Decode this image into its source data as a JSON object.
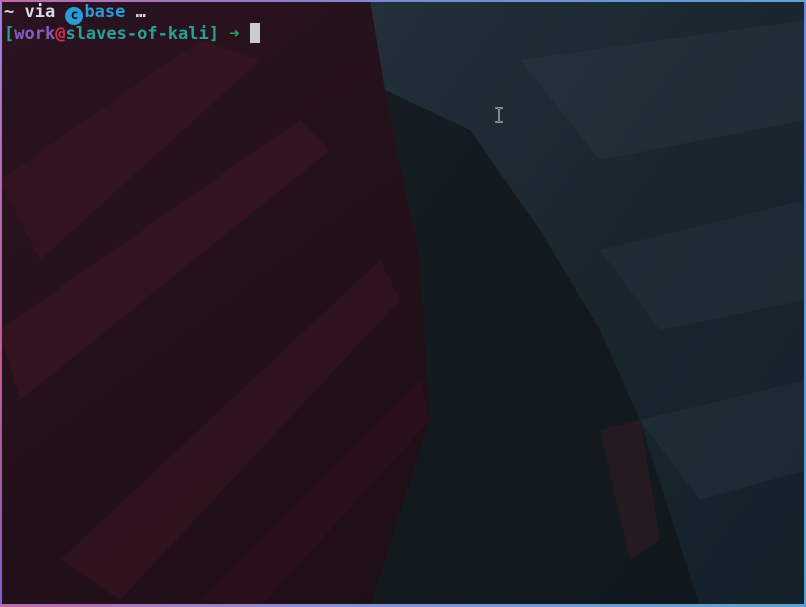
{
  "prompt_line1": {
    "tilde": "~",
    "via": " via ",
    "env_icon": "c",
    "env_name": "base",
    "ellipsis": " …"
  },
  "prompt_line2": {
    "open_bracket": "[",
    "user": "work",
    "at": "@",
    "host": "slaves-of-kali",
    "close_bracket": "]",
    "arrow": " ➜ "
  },
  "icons": {
    "env_icon": "conda-env-icon",
    "mouse_cursor": "ibeam-cursor-icon"
  },
  "colors": {
    "env": "#2a9ad8",
    "bracket_host": "#2aa198",
    "user": "#8a5cc0",
    "at": "#d2304e",
    "arrow": "#2e9d6a",
    "text": "#d8dce6"
  }
}
